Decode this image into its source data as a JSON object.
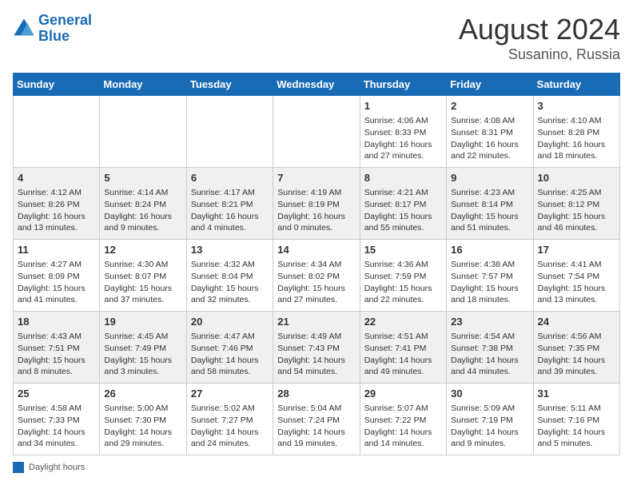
{
  "header": {
    "logo_general": "General",
    "logo_blue": "Blue",
    "month_year": "August 2024",
    "location": "Susanino, Russia"
  },
  "weekdays": [
    "Sunday",
    "Monday",
    "Tuesday",
    "Wednesday",
    "Thursday",
    "Friday",
    "Saturday"
  ],
  "weeks": [
    [
      {
        "day": "",
        "info": ""
      },
      {
        "day": "",
        "info": ""
      },
      {
        "day": "",
        "info": ""
      },
      {
        "day": "",
        "info": ""
      },
      {
        "day": "1",
        "info": "Sunrise: 4:06 AM\nSunset: 8:33 PM\nDaylight: 16 hours and 27 minutes."
      },
      {
        "day": "2",
        "info": "Sunrise: 4:08 AM\nSunset: 8:31 PM\nDaylight: 16 hours and 22 minutes."
      },
      {
        "day": "3",
        "info": "Sunrise: 4:10 AM\nSunset: 8:28 PM\nDaylight: 16 hours and 18 minutes."
      }
    ],
    [
      {
        "day": "4",
        "info": "Sunrise: 4:12 AM\nSunset: 8:26 PM\nDaylight: 16 hours and 13 minutes."
      },
      {
        "day": "5",
        "info": "Sunrise: 4:14 AM\nSunset: 8:24 PM\nDaylight: 16 hours and 9 minutes."
      },
      {
        "day": "6",
        "info": "Sunrise: 4:17 AM\nSunset: 8:21 PM\nDaylight: 16 hours and 4 minutes."
      },
      {
        "day": "7",
        "info": "Sunrise: 4:19 AM\nSunset: 8:19 PM\nDaylight: 16 hours and 0 minutes."
      },
      {
        "day": "8",
        "info": "Sunrise: 4:21 AM\nSunset: 8:17 PM\nDaylight: 15 hours and 55 minutes."
      },
      {
        "day": "9",
        "info": "Sunrise: 4:23 AM\nSunset: 8:14 PM\nDaylight: 15 hours and 51 minutes."
      },
      {
        "day": "10",
        "info": "Sunrise: 4:25 AM\nSunset: 8:12 PM\nDaylight: 15 hours and 46 minutes."
      }
    ],
    [
      {
        "day": "11",
        "info": "Sunrise: 4:27 AM\nSunset: 8:09 PM\nDaylight: 15 hours and 41 minutes."
      },
      {
        "day": "12",
        "info": "Sunrise: 4:30 AM\nSunset: 8:07 PM\nDaylight: 15 hours and 37 minutes."
      },
      {
        "day": "13",
        "info": "Sunrise: 4:32 AM\nSunset: 8:04 PM\nDaylight: 15 hours and 32 minutes."
      },
      {
        "day": "14",
        "info": "Sunrise: 4:34 AM\nSunset: 8:02 PM\nDaylight: 15 hours and 27 minutes."
      },
      {
        "day": "15",
        "info": "Sunrise: 4:36 AM\nSunset: 7:59 PM\nDaylight: 15 hours and 22 minutes."
      },
      {
        "day": "16",
        "info": "Sunrise: 4:38 AM\nSunset: 7:57 PM\nDaylight: 15 hours and 18 minutes."
      },
      {
        "day": "17",
        "info": "Sunrise: 4:41 AM\nSunset: 7:54 PM\nDaylight: 15 hours and 13 minutes."
      }
    ],
    [
      {
        "day": "18",
        "info": "Sunrise: 4:43 AM\nSunset: 7:51 PM\nDaylight: 15 hours and 8 minutes."
      },
      {
        "day": "19",
        "info": "Sunrise: 4:45 AM\nSunset: 7:49 PM\nDaylight: 15 hours and 3 minutes."
      },
      {
        "day": "20",
        "info": "Sunrise: 4:47 AM\nSunset: 7:46 PM\nDaylight: 14 hours and 58 minutes."
      },
      {
        "day": "21",
        "info": "Sunrise: 4:49 AM\nSunset: 7:43 PM\nDaylight: 14 hours and 54 minutes."
      },
      {
        "day": "22",
        "info": "Sunrise: 4:51 AM\nSunset: 7:41 PM\nDaylight: 14 hours and 49 minutes."
      },
      {
        "day": "23",
        "info": "Sunrise: 4:54 AM\nSunset: 7:38 PM\nDaylight: 14 hours and 44 minutes."
      },
      {
        "day": "24",
        "info": "Sunrise: 4:56 AM\nSunset: 7:35 PM\nDaylight: 14 hours and 39 minutes."
      }
    ],
    [
      {
        "day": "25",
        "info": "Sunrise: 4:58 AM\nSunset: 7:33 PM\nDaylight: 14 hours and 34 minutes."
      },
      {
        "day": "26",
        "info": "Sunrise: 5:00 AM\nSunset: 7:30 PM\nDaylight: 14 hours and 29 minutes."
      },
      {
        "day": "27",
        "info": "Sunrise: 5:02 AM\nSunset: 7:27 PM\nDaylight: 14 hours and 24 minutes."
      },
      {
        "day": "28",
        "info": "Sunrise: 5:04 AM\nSunset: 7:24 PM\nDaylight: 14 hours and 19 minutes."
      },
      {
        "day": "29",
        "info": "Sunrise: 5:07 AM\nSunset: 7:22 PM\nDaylight: 14 hours and 14 minutes."
      },
      {
        "day": "30",
        "info": "Sunrise: 5:09 AM\nSunset: 7:19 PM\nDaylight: 14 hours and 9 minutes."
      },
      {
        "day": "31",
        "info": "Sunrise: 5:11 AM\nSunset: 7:16 PM\nDaylight: 14 hours and 5 minutes."
      }
    ]
  ],
  "footer": {
    "daylight_label": "Daylight hours"
  }
}
